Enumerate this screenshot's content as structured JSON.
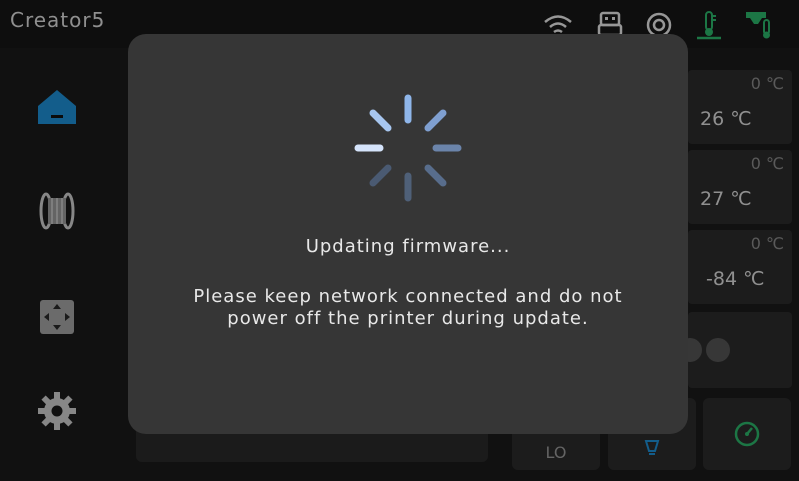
{
  "app": {
    "title": "Creator5"
  },
  "status_icons": [
    "wifi-icon",
    "usb-icon",
    "camera-icon",
    "bed-temperature-icon",
    "nozzle-temperature-icon"
  ],
  "sidebar": {
    "items": [
      {
        "name": "home",
        "icon": "home-icon",
        "active": true
      },
      {
        "name": "filament",
        "icon": "filament-spool-icon",
        "active": false
      },
      {
        "name": "move",
        "icon": "move-axis-icon",
        "active": false
      },
      {
        "name": "settings",
        "icon": "gear-icon",
        "active": false
      }
    ]
  },
  "temperatures": [
    {
      "target": "0 ℃",
      "current": "26 ℃"
    },
    {
      "target": "0 ℃",
      "current": "27 ℃"
    },
    {
      "target": "0 ℃",
      "current": "-84 ℃"
    }
  ],
  "bottom_buttons": [
    {
      "label": "LO",
      "icon": ""
    },
    {
      "label": "",
      "icon": "light-bulb-icon"
    },
    {
      "label": "",
      "icon": "speed-gauge-icon"
    }
  ],
  "modal": {
    "title": "Updating firmware...",
    "message_line1": "Please keep network connected and do not",
    "message_line2": "power off the printer during update."
  },
  "colors": {
    "accent_blue": "#1e8fd6",
    "accent_green": "#2bb56a",
    "spinner_light": "#8fb6ea",
    "spinner_dark": "#4a5a72"
  }
}
